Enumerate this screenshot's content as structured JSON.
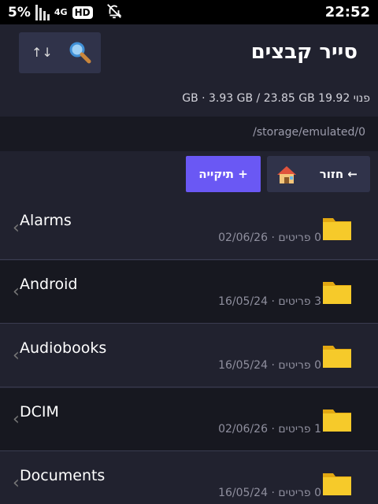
{
  "status_bar": {
    "battery": "5%",
    "network": "4G",
    "hd": "HD",
    "time": "22:52"
  },
  "header": {
    "title": "סייר קבצים",
    "storage": "פנוי 19.92 GB · 3.93 GB / 23.85 GB",
    "sort_icon": "↑↓",
    "search_icon": "search-icon"
  },
  "path": "/storage/emulated/0",
  "actions": {
    "back_label": "← חזור",
    "new_folder_label": "+ תיקייה"
  },
  "folders": [
    {
      "name": "Alarms",
      "meta": "0 פריטים · 02/06/26"
    },
    {
      "name": "Android",
      "meta": "3 פריטים · 16/05/24"
    },
    {
      "name": "Audiobooks",
      "meta": "0 פריטים · 16/05/24"
    },
    {
      "name": "DCIM",
      "meta": "1 פריטים · 02/06/26"
    },
    {
      "name": "Documents",
      "meta": "0 פריטים · 16/05/24"
    }
  ],
  "colors": {
    "accent": "#6a58f4",
    "background": "#21222f",
    "folder": "#f5c211"
  }
}
